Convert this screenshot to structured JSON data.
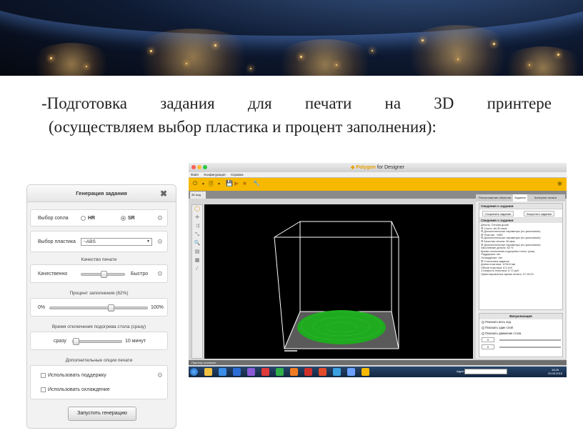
{
  "slide": {
    "heading_line1": "-Подготовка задания для печати на 3D принтере",
    "heading_line2": "(осуществляем выбор пластика и процент заполнения):"
  },
  "dialog": {
    "title": "Генерация задания",
    "nozzle": {
      "label": "Выбор сопла",
      "option_hr": "HR",
      "option_sr": "SR",
      "selected": "SR"
    },
    "plastic": {
      "label": "Выбор пластика",
      "value": "~ABS"
    },
    "quality": {
      "section": "Качество печати",
      "left": "Качественно",
      "right": "Быстро",
      "level": 0.5
    },
    "infill": {
      "section": "Процент заполнения (62%)",
      "min": "0%",
      "max": "100%",
      "level": 0.62
    },
    "heat_off": {
      "section": "Время отключения подогрева стола (сразу)",
      "left": "сразу",
      "right": "10 минут",
      "level": 0.0
    },
    "extra": {
      "section": "Дополнительные опции печати",
      "support": "Использовать поддержку",
      "cooling": "Использовать охлаждение"
    },
    "run_button": "Запустить генерацию"
  },
  "app": {
    "title_brand": "Polygon",
    "title_suffix": " for Designer",
    "menu": [
      "Файл",
      "Конфигурация",
      "Справка"
    ],
    "view_tab": "3D вид",
    "panel_tabs": [
      "Расположение объектов",
      "Задание",
      "Контроль печати"
    ],
    "panel_active_tab": "Задание",
    "task_header": "Сведения о задании",
    "save_button": "Сохранить задание",
    "print_button": "Запустить задание",
    "task_subheader": "Сведения о задании",
    "tree": [
      "Деталь: Основа.gcode",
      "⊟ Сопло: ø0.30 мм/s",
      "    ⊟ Дополнительные параметры (по умолчанию)",
      "⊟ Пластик: ~ABS",
      "    ⊟ Дополнительные параметры (по умолчанию)",
      "⊟ Качество печати: 60 мкм",
      "    ⊟ Дополнительные параметры (по умолчанию)",
      "    Заполнение детали: 62 %",
      "    Время отключения подогрева стола: сразу",
      "    Поддержка: нет",
      "    Охлаждение: нет",
      "⊟ Статистика задания",
      "    Длина пластика: 1236.8 мм",
      "    Объем пластика: 8.3 cm³",
      "    Стоимость пластика: 6.72 руб.",
      "    Ориентировочное время печати: 27:15:23"
    ],
    "viz_header": "Визуализация",
    "viz_options": [
      "Показать весь ход",
      "Показать один слой",
      "Показать движение стола"
    ],
    "viz_values": [
      "0",
      "0"
    ],
    "status": "Принтер отключен",
    "taskbar_addr_label": "Адрес",
    "clock_time": "18:26",
    "clock_date": "20.05.2016",
    "colors": {
      "toolbar": "#f7b900",
      "model": "#1faa1f",
      "wire": "#ffffff"
    }
  }
}
